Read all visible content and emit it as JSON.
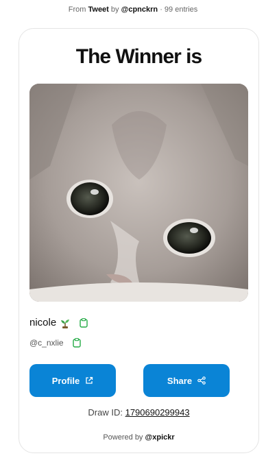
{
  "header": {
    "from_label": "From",
    "source_link": "Tweet",
    "by_label": "by",
    "author_link": "@cpnckrn",
    "separator": "·",
    "entries": "99 entries"
  },
  "card": {
    "title": "The Winner is",
    "winner": {
      "name": "nicole",
      "emoji_icon": "seedling-icon",
      "handle": "@c_nxlie"
    },
    "buttons": {
      "profile_label": "Profile",
      "share_label": "Share"
    },
    "draw": {
      "label": "Draw ID:",
      "id": "1790690299943"
    },
    "powered": {
      "label": "Powered by",
      "brand": "@xpickr"
    }
  },
  "colors": {
    "accent": "#0a84d6",
    "copy_icon": "#22aa44",
    "card_border": "#e4e4e4"
  }
}
